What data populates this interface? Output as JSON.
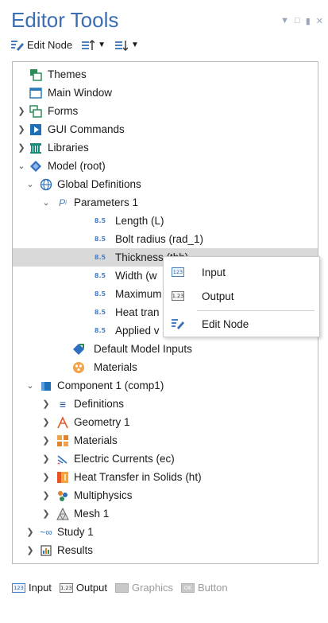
{
  "panel": {
    "title": "Editor Tools"
  },
  "toolbar": {
    "edit_node_label": "Edit Node"
  },
  "tree": [
    {
      "label": "Themes",
      "icon": "themes-icon"
    },
    {
      "label": "Main Window",
      "icon": "window-icon"
    },
    {
      "label": "Forms",
      "icon": "forms-icon"
    },
    {
      "label": "GUI Commands",
      "icon": "gui-commands-icon"
    },
    {
      "label": "Libraries",
      "icon": "libraries-icon"
    },
    {
      "label": "Model (root)",
      "icon": "model-icon"
    },
    {
      "label": "Global Definitions",
      "icon": "globe-icon"
    },
    {
      "label": "Parameters 1",
      "icon": "parameters-icon"
    },
    {
      "label": "Length (L)",
      "icon": "parameter-value-icon"
    },
    {
      "label": "Bolt radius (rad_1)",
      "icon": "parameter-value-icon"
    },
    {
      "label": "Thickness (thh)",
      "icon": "parameter-value-icon"
    },
    {
      "label": "Width (w",
      "icon": "parameter-value-icon"
    },
    {
      "label": "Maximum",
      "icon": "parameter-value-icon"
    },
    {
      "label": "Heat tran",
      "icon": "parameter-value-icon"
    },
    {
      "label": "Applied v",
      "icon": "parameter-value-icon"
    },
    {
      "label": "Default Model Inputs",
      "icon": "default-inputs-icon"
    },
    {
      "label": "Materials",
      "icon": "materials-icon"
    },
    {
      "label": "Component 1 (comp1)",
      "icon": "component-icon"
    },
    {
      "label": "Definitions",
      "icon": "definitions-icon"
    },
    {
      "label": "Geometry 1",
      "icon": "geometry-icon"
    },
    {
      "label": "Materials",
      "icon": "materials-icon"
    },
    {
      "label": "Electric Currents (ec)",
      "icon": "electric-currents-icon"
    },
    {
      "label": "Heat Transfer in Solids (ht)",
      "icon": "heat-transfer-icon"
    },
    {
      "label": "Multiphysics",
      "icon": "multiphysics-icon"
    },
    {
      "label": "Mesh 1",
      "icon": "mesh-icon"
    },
    {
      "label": "Study 1",
      "icon": "study-icon"
    },
    {
      "label": "Results",
      "icon": "results-icon"
    }
  ],
  "context_menu": {
    "items": [
      {
        "label": "Input",
        "icon": "input-icon"
      },
      {
        "label": "Output",
        "icon": "output-icon"
      },
      {
        "label": "Edit Node",
        "icon": "edit-node-icon"
      }
    ]
  },
  "legend": {
    "input": "Input",
    "output": "Output",
    "graphics": "Graphics",
    "button": "Button",
    "badge_input": "123",
    "badge_output": "1.23",
    "badge_button": "OK"
  },
  "colors": {
    "title": "#3b6db3",
    "selected_row": "#d9d9d9",
    "accent_blue": "#4a7fc1"
  }
}
